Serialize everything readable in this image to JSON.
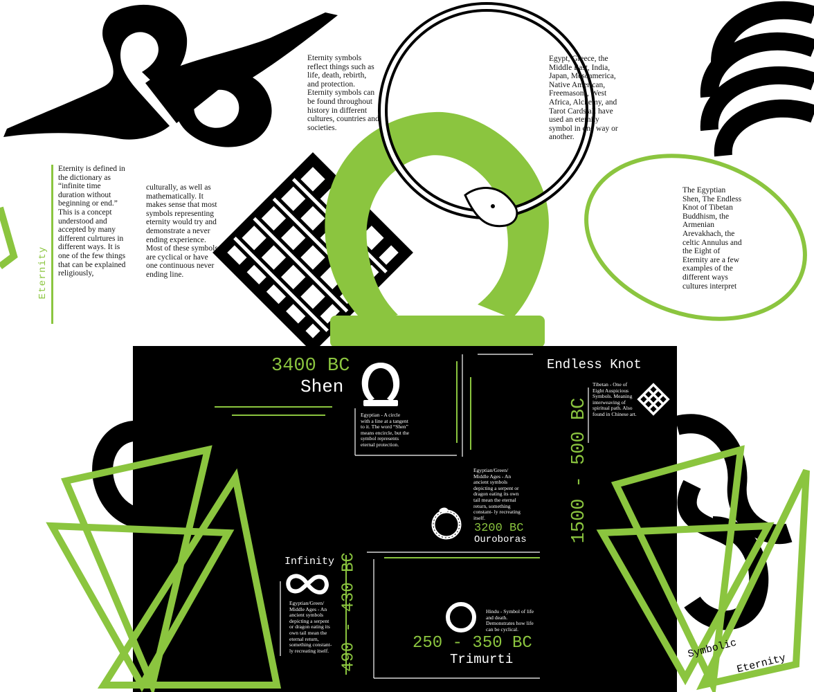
{
  "colors": {
    "accent": "#8bc53f",
    "ink": "#000000",
    "paper": "#ffffff"
  },
  "intro": {
    "side_title": "Eternity",
    "para_left": "Eternity is defined in the dictionary as “infinite time duration without beginning or end.” This is a concept understood and accepted by many different culrtures in different ways. It is one of the few things that can be explained religiously,",
    "para_right": "culturally, as well as mathematically. It makes sense that most symbols representing eternity would try and demonstrate a never ending experience. Most of these symbols are cyclical or have one continuous never ending line.",
    "para_top": "Eternity symbols reflect things such as life, death, rebirth, and protection. Eternity symbols can be found throughout history in different cultures, countries and societies.",
    "para_cultures": "Egypt, Greece, the Middle East, India, Japan, Mesoamerica, Native American, Freemasons, West Africa, Alchemy, and Tarot Cards all have used an eternity symbol in one way or another.",
    "para_examples": "The Egyptian Shen, The Endless Knot of Tibetan Buddhism, the Armenian Arevakhach, the celtic Annulus and the Eight of Eternity are a few examples of the different ways cultures interpret"
  },
  "timeline": {
    "shen": {
      "date": "3400 BC",
      "name": "Shen",
      "desc": "Egyptian - A circle with a line at a tangent to it. The word “Shen” means encircle, but the symbol represents eternal protection.",
      "icon": "shen-icon"
    },
    "endless_knot": {
      "name": "Endless Knot",
      "date": "1500 - 500 BC",
      "desc": "Tibetan - One of Eight Auspicious Symbols. Meaning interweaving of spiritual path. Also found in Chinese art.",
      "icon": "endless-knot-icon"
    },
    "ouroboros": {
      "date": "3200 BC",
      "name": "Ouroboras",
      "desc": "Egyptian/Green/ Middle Ages - An ancient symbols depicting a serpent or dragon eating its own tail mean the eternal return, something constant- ly recreating itself.",
      "icon": "ouroboros-icon"
    },
    "infinity": {
      "name": "Infinity",
      "date": "490 - 430 BC",
      "desc": "Egyptian/Green/ Middle Ages - An ancient symbols depicting a serpent or dragon eating its own tail mean the eternal return, something constant- ly recreating itself.",
      "icon": "infinity-icon"
    },
    "trimurti": {
      "date": "250 - 350 BC",
      "name": "Trimurti",
      "desc": "Hindu - Symbol of life and death. Demonstrates how life can be cyclical.",
      "icon": "trimurti-circle-icon"
    }
  },
  "footer": {
    "line1": "Symbolic",
    "line2": "Eternity"
  }
}
